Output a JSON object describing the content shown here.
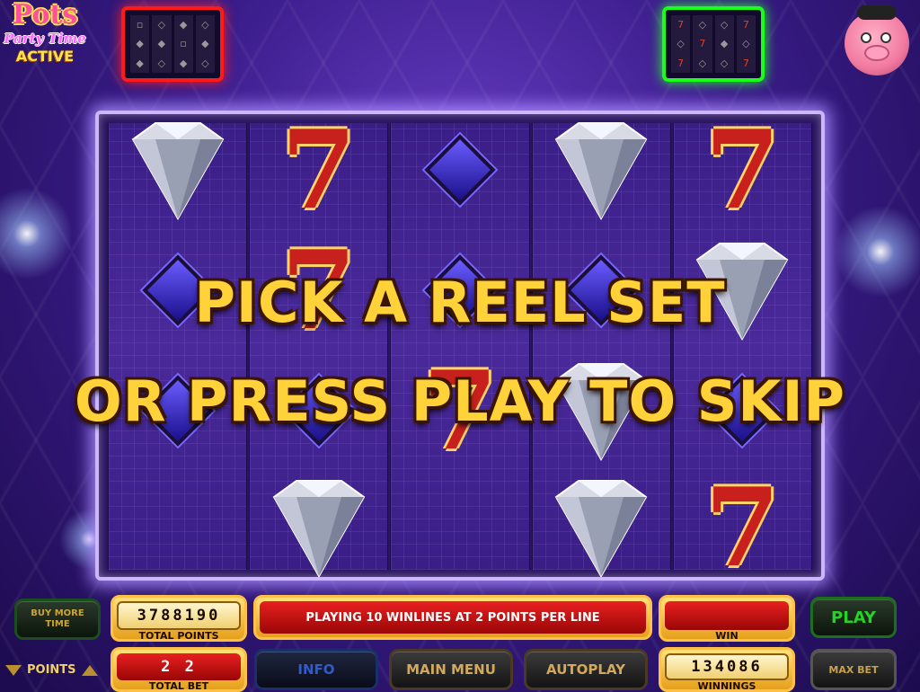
{
  "logo": {
    "line1": "Pots",
    "line2": "Party Time",
    "line3": "ACTIVE"
  },
  "reel_sets": [
    {
      "name": "red",
      "color": "#ff1a1a"
    },
    {
      "name": "green",
      "color": "#1aff1a"
    }
  ],
  "message": {
    "line1": "PICK A REEL SET",
    "line2": "OR PRESS PLAY TO SKIP"
  },
  "reels": [
    [
      "diamond",
      "blue-gem",
      "blue-gem",
      ""
    ],
    [
      "seven",
      "seven",
      "blue-gem",
      "diamond"
    ],
    [
      "blue-gem",
      "blue-gem",
      "seven",
      ""
    ],
    [
      "diamond",
      "blue-gem",
      "diamond",
      "diamond"
    ],
    [
      "seven",
      "diamond",
      "blue-gem",
      "seven"
    ]
  ],
  "controls": {
    "buy_more_time": "BUY MORE TIME",
    "total_points_value": "3788190",
    "total_points_label": "TOTAL POINTS",
    "status": "PLAYING 10 WINLINES AT 2 POINTS PER LINE",
    "win_value": "",
    "win_label": "WIN",
    "play": "PLAY",
    "points_label": "POINTS",
    "total_bet_value": "2 2",
    "total_bet_label": "TOTAL BET",
    "info": "INFO",
    "main_menu": "MAIN MENU",
    "autoplay": "AUTOPLAY",
    "winnings_value": "134086",
    "winnings_label": "WINNINGS",
    "max_bet": "MAX BET"
  },
  "colors": {
    "accent_gold": "#ffd23a",
    "panel_red": "#c81010",
    "play_green": "#2ad02a"
  }
}
